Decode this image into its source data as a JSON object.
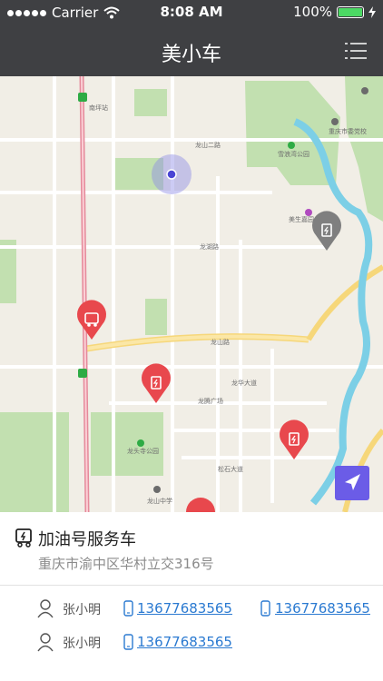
{
  "status_bar": {
    "carrier": "Carrier",
    "time": "8:08 AM",
    "battery": "100%"
  },
  "navbar": {
    "title": "美小车",
    "menu_icon": "list-menu-icon"
  },
  "map": {
    "labels": {
      "metro": "南坪站",
      "park1": "雪浪湾公园",
      "road1": "龙山路",
      "park2": "龙头寺公园",
      "school": "龙山中学",
      "road2": "龙湖路",
      "road3": "龙山二路",
      "road4": "龙腾广场",
      "road5": "龙华大道",
      "road6": "美生嘉园",
      "road7": "重庆市委党校",
      "road8": "松石大道"
    },
    "colors": {
      "park": "#c2e0b0",
      "river": "#7ccfe6",
      "pin": "#e8484d",
      "pin_gray": "#7f7f7f",
      "location": "#5b57d9"
    }
  },
  "service": {
    "name": "加油号服务车",
    "address": "重庆市渝中区华村立交316号",
    "contacts": [
      {
        "name": "张小明",
        "phone1": "13677683565",
        "phone2": "13677683565"
      },
      {
        "name": "张小明",
        "phone1": "13677683565"
      }
    ]
  }
}
